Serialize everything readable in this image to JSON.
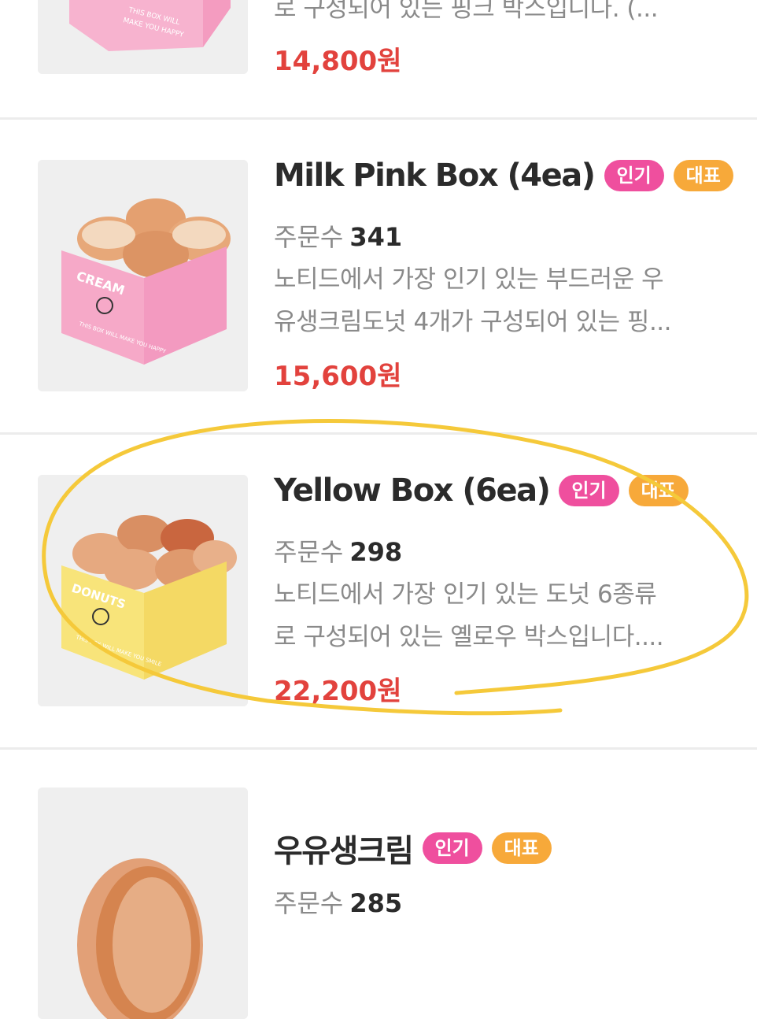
{
  "products": [
    {
      "desc_lines": [
        "로 구성되어 있는 핑크 박스입니다. (..."
      ],
      "price": "14,800원",
      "box_color": "#f7b3cf"
    },
    {
      "title": "Milk Pink Box (4ea)",
      "badges": [
        "인기",
        "대표"
      ],
      "orders_label": "주문수",
      "orders": "341",
      "desc_lines": [
        "노티드에서 가장 인기 있는 부드러운 우",
        "유생크림도넛 4개가 구성되어 있는 핑..."
      ],
      "price": "15,600원",
      "box_text": "CREAM",
      "box_slogan": "THIS BOX WILL MAKE YOU HAPPY",
      "box_color": "#f6a9c8"
    },
    {
      "title": "Yellow Box (6ea)",
      "badges": [
        "인기",
        "대표"
      ],
      "orders_label": "주문수",
      "orders": "298",
      "desc_lines": [
        "노티드에서 가장 인기 있는 도넛 6종류",
        "로 구성되어 있는 옐로우 박스입니다...."
      ],
      "price": "22,200원",
      "box_text": "DONUTS",
      "box_slogan": "THIS BOX WILL MAKE YOU SMILE",
      "box_color": "#f8e47a"
    },
    {
      "title": "우유생크림",
      "badges": [
        "인기",
        "대표"
      ],
      "orders_label": "주문수",
      "orders": "285"
    }
  ],
  "colors": {
    "price": "#e2423d",
    "badge_popular": "#ef4f9e",
    "badge_signature": "#f7a93a",
    "annotation": "#f5c93a"
  },
  "icons": {
    "annotation": "hand-drawn-circle"
  }
}
